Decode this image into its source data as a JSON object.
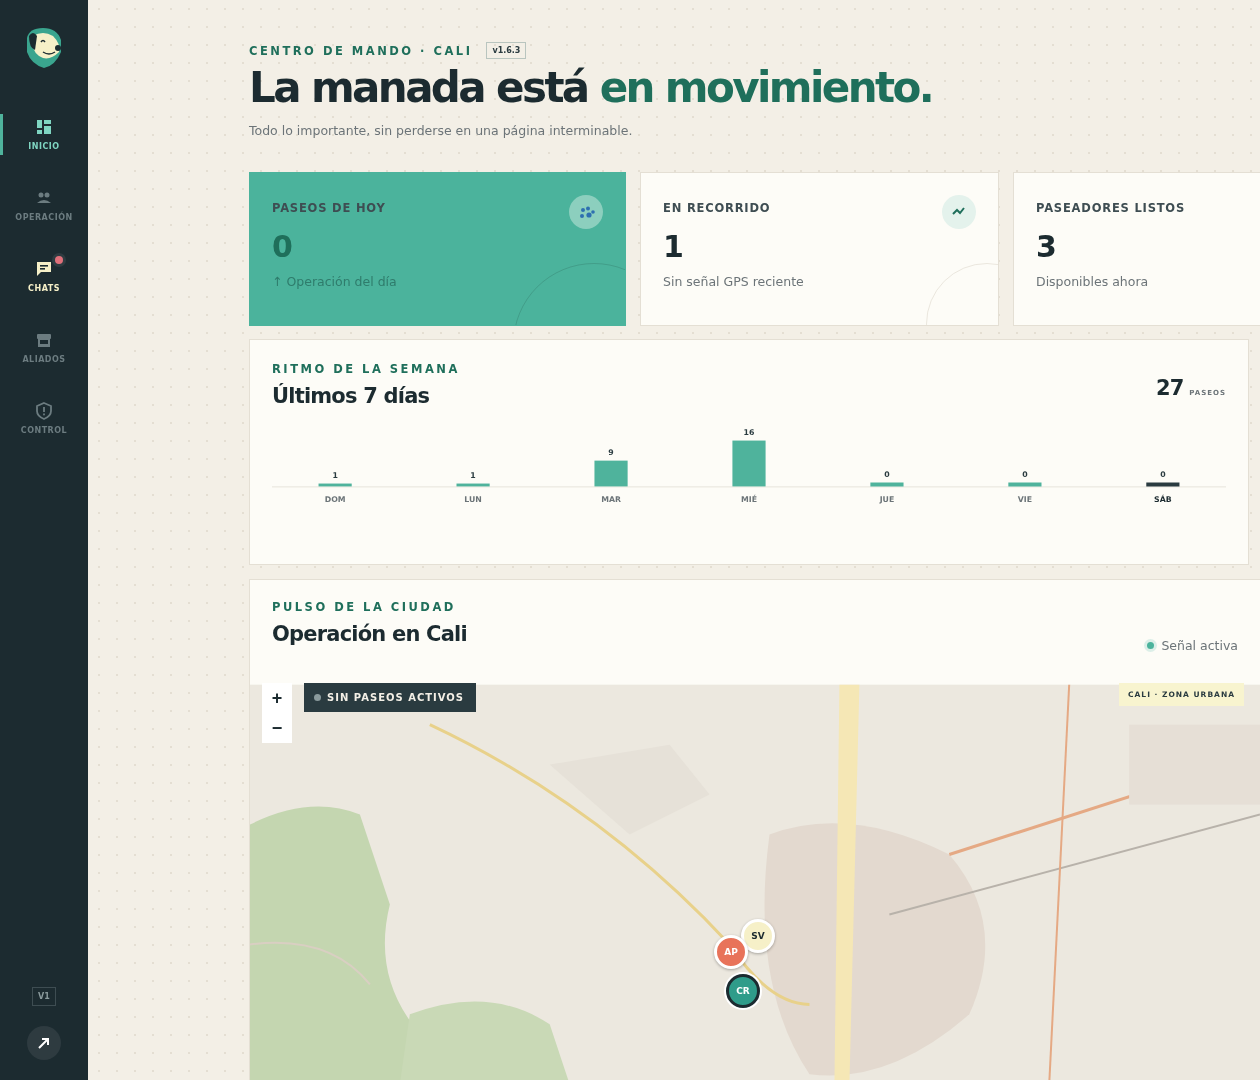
{
  "sidebar": {
    "items": [
      {
        "label": "INICIO",
        "selected": true,
        "unread": false
      },
      {
        "label": "OPERACIÓN",
        "selected": false,
        "unread": false
      },
      {
        "label": "CHATS",
        "selected": false,
        "unread": true
      },
      {
        "label": "ALIADOS",
        "selected": false,
        "unread": false
      },
      {
        "label": "CONTROL",
        "selected": false,
        "unread": false
      }
    ],
    "version": "V1"
  },
  "header": {
    "eyebrow": "CENTRO DE MANDO · CALI",
    "version": "v1.6.3",
    "title_plain": "La manada está",
    "title_accent": "en movimiento.",
    "subtitle": "Todo lo importante, sin perderse en una página interminable."
  },
  "stats": [
    {
      "kind": "accent",
      "label": "PASEOS DE HOY",
      "value": "0",
      "note": "↑ Operación del día"
    },
    {
      "kind": "plain",
      "label": "EN RECORRIDO",
      "value": "1",
      "note": "Sin señal GPS reciente"
    },
    {
      "kind": "plain",
      "label": "PASEADORES LISTOS",
      "value": "3",
      "note": "Disponibles ahora"
    }
  ],
  "week": {
    "eyebrow": "RITMO DE LA SEMANA",
    "title": "Últimos 7 días",
    "total": "27",
    "total_unit": "PASEOS",
    "chart_data": {
      "type": "bar",
      "categories": [
        "DOM",
        "LUN",
        "MAR",
        "MIÉ",
        "JUE",
        "VIE",
        "SÁB"
      ],
      "series": [
        {
          "color": "#4fb39c",
          "values": [
            1,
            1,
            9,
            16,
            0,
            0,
            0
          ]
        }
      ],
      "data_labels": true
    },
    "bars": [
      {
        "selected": false
      },
      {
        "selected": false
      },
      {
        "selected": false
      },
      {
        "selected": false
      },
      {
        "selected": false
      },
      {
        "selected": false
      },
      {
        "selected": true
      }
    ]
  },
  "city": {
    "eyebrow": "PULSO DE LA CIUDAD",
    "title": "Operación en Cali",
    "status": "Señal activa",
    "status_on": true,
    "map": {
      "kind": "picture",
      "zoom_in": "+",
      "zoom_out": "−",
      "badge": "SIN PASEOS ACTIVOS",
      "zone": "CALI · ZONA URBANA",
      "markers": [
        {
          "label": "SV",
          "color": "#f6f0c8"
        },
        {
          "label": "AP",
          "color": "#e8735a"
        },
        {
          "label": "CR",
          "color": "#2f9c8a"
        }
      ]
    }
  }
}
